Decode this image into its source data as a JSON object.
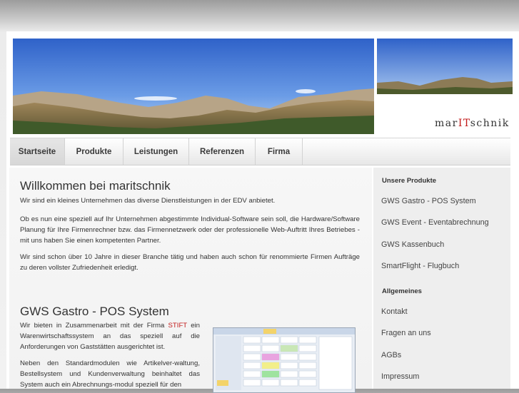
{
  "logo": {
    "prefix": "mar",
    "highlight": "IT",
    "suffix": "schnik"
  },
  "nav": [
    "Startseite",
    "Produkte",
    "Leistungen",
    "Referenzen",
    "Firma"
  ],
  "welcome": {
    "title": "Willkommen bei maritschnik",
    "p1": "Wir sind ein kleines Unternehmen das diverse Dienstleistungen in der EDV anbietet.",
    "p2": "Ob es nun eine speziell auf Ihr Unternehmen abgestimmte Individual-Software sein soll, die Hardware/Software Planung für Ihre Firmenrechner bzw. das Firmennetzwerk oder der professionelle Web-Auftritt Ihres Betriebes - mit uns haben Sie einen kompetenten Partner.",
    "p3": "Wir sind schon über 10 Jahre in dieser Branche tätig und haben auch schon für renommierte Firmen Aufträge zu deren vollster Zufriedenheit erledigt."
  },
  "gws": {
    "title": "GWS Gastro - POS System",
    "p1_before": "Wir bieten in Zusammenarbeit mit der Firma ",
    "p1_brand": "STIFT",
    "p1_after": " ein Warenwirtschaftssystem an das speziell auf die Anforderungen von Gaststätten ausgerichtet ist.",
    "p2": "Neben den Standardmodulen wie Artikelver-waltung, Bestellsystem und Kundenverwaltung beinhaltet das System auch ein Abrechnungs-modul speziell für den"
  },
  "sidebar": {
    "heading1": "Unsere Produkte",
    "products": [
      "GWS Gastro - POS System",
      "GWS Event - Eventabrechnung",
      "GWS Kassenbuch",
      "SmartFlight - Flugbuch"
    ],
    "heading2": "Allgemeines",
    "general": [
      "Kontakt",
      "Fragen an uns",
      "AGBs",
      "Impressum"
    ]
  },
  "colors": {
    "accent": "#c21a1a",
    "sky_top": "#3f6fd0",
    "mountain": "#7a6a45"
  }
}
